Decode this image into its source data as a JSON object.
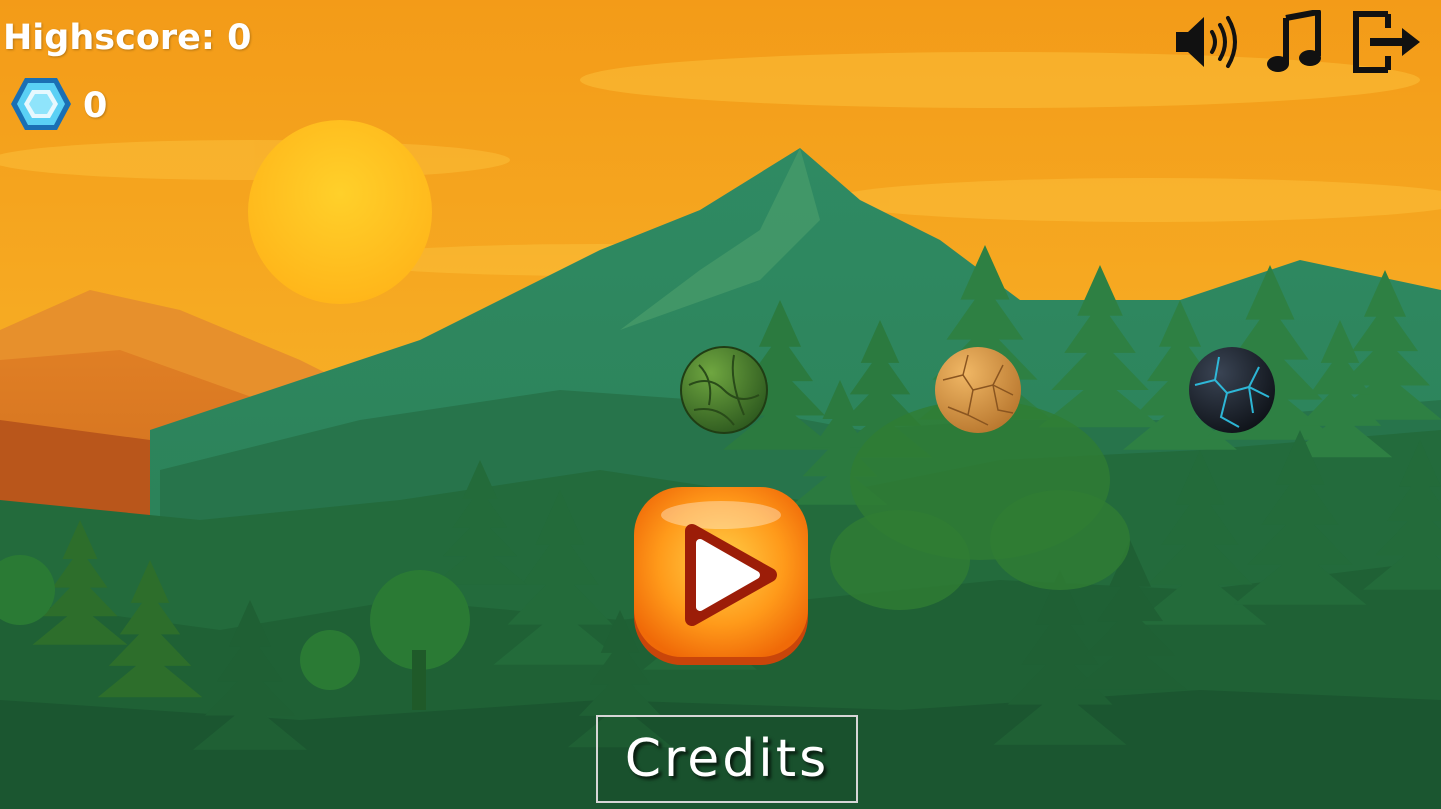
{
  "hud": {
    "highscore_text": "Highscore: 0",
    "gem_count": "0",
    "gem_icon": "hexagon-gem-icon"
  },
  "controls": {
    "sound_icon": "speaker-volume-icon",
    "music_icon": "music-note-icon",
    "exit_icon": "exit-door-icon"
  },
  "balls": [
    {
      "name": "leaf-ball",
      "color": "#4a7a2a"
    },
    {
      "name": "sand-ball",
      "color": "#d49a4c"
    },
    {
      "name": "lava-ball",
      "color": "#1d2430"
    }
  ],
  "play_button": {
    "icon": "play-triangle-icon",
    "color": "#ff8a0d"
  },
  "credits_button": {
    "label": "Credits"
  },
  "colors": {
    "sky_top": "#f5a51d",
    "sky_mid": "#f7b52a",
    "sun": "#ffc21f",
    "mountain": "#2d8a63",
    "forest_dark": "#1f5e32",
    "forest_mid": "#2b7a3a",
    "hill_orange": "#d8741e"
  }
}
